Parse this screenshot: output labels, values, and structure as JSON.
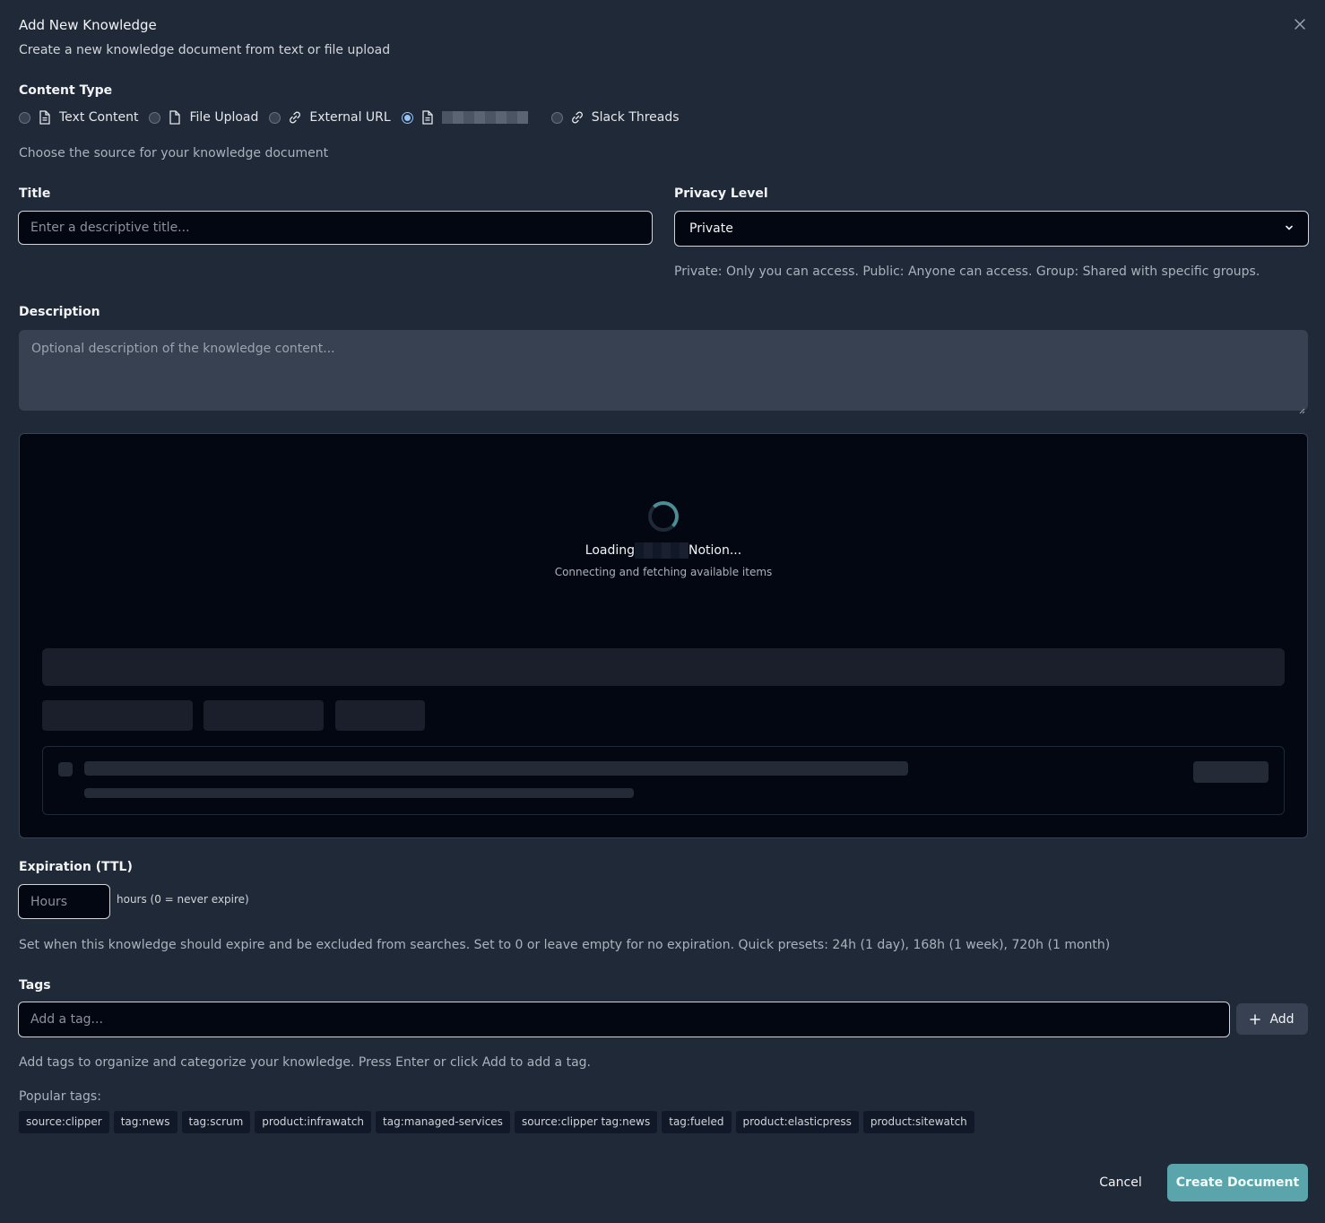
{
  "dialog": {
    "title": "Add New Knowledge",
    "subtitle": "Create a new knowledge document from text or file upload"
  },
  "content_type": {
    "label": "Content Type",
    "options": [
      {
        "label": "Text Content",
        "icon": "file-text-icon",
        "checked": false
      },
      {
        "label": "File Upload",
        "icon": "file-icon",
        "checked": false
      },
      {
        "label": "External URL",
        "icon": "link-icon",
        "checked": false
      },
      {
        "label": "",
        "icon": "file-text-icon",
        "checked": true
      },
      {
        "label": "Slack Threads",
        "icon": "link-icon",
        "checked": false
      }
    ],
    "help": "Choose the source for your knowledge document"
  },
  "title_field": {
    "label": "Title",
    "placeholder": "Enter a descriptive title..."
  },
  "privacy": {
    "label": "Privacy Level",
    "value": "Private",
    "help": "Private: Only you can access. Public: Anyone can access. Group: Shared with specific groups."
  },
  "description": {
    "label": "Description",
    "placeholder": "Optional description of the knowledge content..."
  },
  "loader": {
    "title_prefix": "Loading",
    "title_suffix": "Notion...",
    "subtitle": "Connecting and fetching available items"
  },
  "expiration": {
    "label": "Expiration (TTL)",
    "placeholder": "Hours",
    "suffix": "hours (0 = never expire)",
    "help": "Set when this knowledge should expire and be excluded from searches. Set to 0 or leave empty for no expiration. Quick presets: 24h (1 day), 168h (1 week), 720h (1 month)"
  },
  "tags": {
    "label": "Tags",
    "placeholder": "Add a tag...",
    "add_label": "Add",
    "help": "Add tags to organize and categorize your knowledge. Press Enter or click Add to add a tag.",
    "popular_label": "Popular tags:",
    "popular": [
      "source:clipper",
      "tag:news",
      "tag:scrum",
      "product:infrawatch",
      "tag:managed-services",
      "source:clipper tag:news",
      "tag:fueled",
      "product:elasticpress",
      "product:sitewatch"
    ]
  },
  "footer": {
    "cancel_label": "Cancel",
    "create_label": "Create Document"
  },
  "colors": {
    "background": "#1f2937",
    "accent": "#5aa5ab",
    "radio_checked": "#93c5fd"
  }
}
